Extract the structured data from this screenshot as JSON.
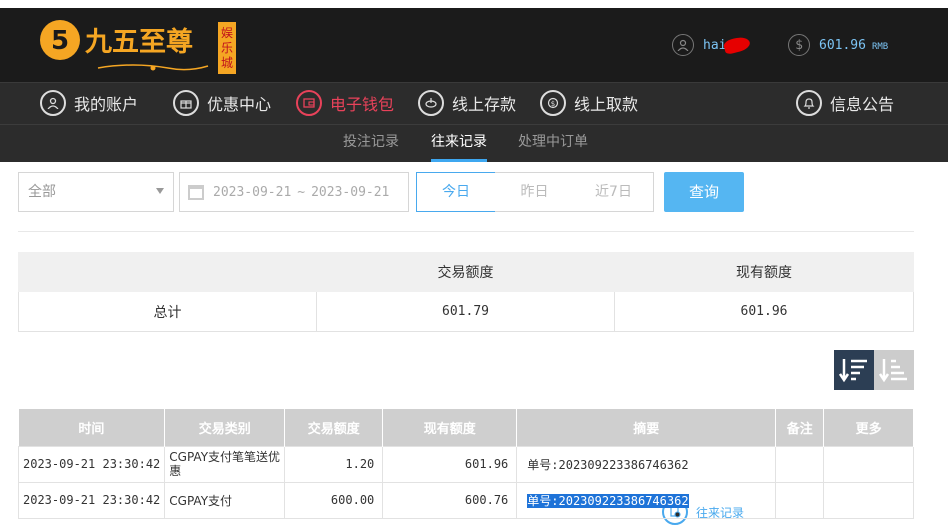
{
  "brand": {
    "name": "九五至尊",
    "tagline": "娱乐城",
    "accent": "#f5a623"
  },
  "header": {
    "username": "hai",
    "balance": "601.96",
    "currency": "RMB"
  },
  "nav": {
    "items": [
      {
        "label": "我的账户",
        "icon": "user-icon"
      },
      {
        "label": "优惠中心",
        "icon": "gift-icon"
      },
      {
        "label": "电子钱包",
        "icon": "wallet-icon"
      },
      {
        "label": "线上存款",
        "icon": "deposit-icon"
      },
      {
        "label": "线上取款",
        "icon": "withdraw-icon"
      },
      {
        "label": "往来记录",
        "icon": "record-icon"
      },
      {
        "label": "信息公告",
        "icon": "bell-icon"
      }
    ],
    "colors": {
      "wallet": "#e8425a",
      "active": "#49a9ee"
    }
  },
  "subnav": {
    "items": [
      "投注记录",
      "往来记录",
      "处理中订单"
    ],
    "active": "往来记录"
  },
  "filters": {
    "type": "全部",
    "date_from": "2023-09-21",
    "date_sep": "~",
    "date_to": "2023-09-21",
    "ranges": [
      "今日",
      "昨日",
      "近7日"
    ],
    "active_range": "今日",
    "query_label": "查询"
  },
  "summary": {
    "headers": [
      "",
      "交易额度",
      "现有额度"
    ],
    "row": {
      "label": "总计",
      "amount": "601.79",
      "balance": "601.96"
    }
  },
  "table": {
    "headers": [
      "时间",
      "交易类别",
      "交易额度",
      "现有额度",
      "摘要",
      "备注",
      "更多"
    ],
    "rows": [
      {
        "time": "2023-09-21 23:30:42",
        "category": "CGPAY支付笔笔送优惠",
        "amount": "1.20",
        "balance": "601.96",
        "memo": "单号:202309223386746362",
        "remark": "",
        "more": ""
      },
      {
        "time": "2023-09-21 23:30:42",
        "category": "CGPAY支付",
        "amount": "600.00",
        "balance": "600.76",
        "memo": "单号:202309223386746362",
        "remark": "",
        "more": ""
      }
    ]
  }
}
